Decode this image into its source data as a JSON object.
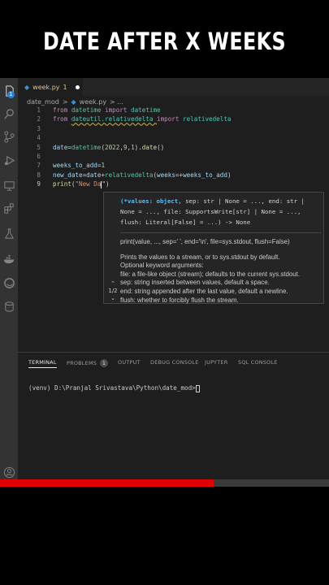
{
  "banner": {
    "title": "DATE AFTER X WEEKS"
  },
  "tab": {
    "filename": "week.py",
    "count": "1"
  },
  "breadcrumb": {
    "folder": "date_mod",
    "sep": ">",
    "file": "week.py",
    "more": "> ..."
  },
  "activity": {
    "badge": "1"
  },
  "code": {
    "lines": [
      {
        "n": "1",
        "parts": [
          [
            "kw",
            "from "
          ],
          [
            "mod",
            "datetime "
          ],
          [
            "kw",
            "import "
          ],
          [
            "mod",
            "datetime"
          ]
        ]
      },
      {
        "n": "2",
        "parts": [
          [
            "kw",
            "from "
          ],
          [
            "mod",
            "dateutil.relativedelta "
          ],
          [
            "kw",
            "import "
          ],
          [
            "mod",
            "relativedelta"
          ]
        ]
      },
      {
        "n": "3",
        "parts": []
      },
      {
        "n": "4",
        "parts": []
      },
      {
        "n": "5",
        "parts": [
          [
            "var",
            "date"
          ],
          [
            "op",
            "="
          ],
          [
            "mod",
            "datetime"
          ],
          [
            "op",
            "("
          ],
          [
            "num",
            "2022"
          ],
          [
            "op",
            ","
          ],
          [
            "num",
            "9"
          ],
          [
            "op",
            ","
          ],
          [
            "num",
            "1"
          ],
          [
            "op",
            ")."
          ],
          [
            "fn",
            "date"
          ],
          [
            "op",
            "()"
          ]
        ]
      },
      {
        "n": "6",
        "parts": []
      },
      {
        "n": "7",
        "parts": [
          [
            "var",
            "weeks_to_add"
          ],
          [
            "op",
            "="
          ],
          [
            "num",
            "1"
          ]
        ]
      },
      {
        "n": "8",
        "parts": [
          [
            "var",
            "new_date"
          ],
          [
            "op",
            "="
          ],
          [
            "var",
            "date"
          ],
          [
            "op",
            "+"
          ],
          [
            "mod",
            "relativedelta"
          ],
          [
            "op",
            "("
          ],
          [
            "var",
            "weeks"
          ],
          [
            "op",
            "=+"
          ],
          [
            "var",
            "weeks_to_add"
          ],
          [
            "op",
            ")"
          ]
        ]
      },
      {
        "n": "9",
        "parts": [
          [
            "fn",
            "print"
          ],
          [
            "op",
            "("
          ],
          [
            "str",
            "\"New Da"
          ],
          [
            "cursor",
            ""
          ],
          [
            "op",
            "\")"
          ]
        ]
      }
    ]
  },
  "hover": {
    "signature_bold": "(*values: object,",
    "signature_rest": " sep: str | None = ..., end: str | None = ..., file: SupportsWrite[str] | None = ..., flush: Literal[False] = ...) -> None",
    "doc_first": "print(value, ..., sep=' ', end='\\n', file=sys.stdout, flush=False)",
    "doc_lines": [
      "Prints the values to a stream, or to sys.stdout by default.",
      "Optional keyword arguments:",
      "file: a file-like object (stream); defaults to the current sys.stdout.",
      "sep: string inserted between values, default a space.",
      "end: string appended after the last value, default a newline.",
      "flush: whether to forcibly flush the stream."
    ],
    "pager": "1/2"
  },
  "panel": {
    "tabs": [
      "TERMINAL",
      "PROBLEMS",
      "OUTPUT",
      "DEBUG CONSOLE",
      "JUPYTER",
      "SQL CONSOLE"
    ],
    "problems_count": "1"
  },
  "terminal": {
    "prompt": "(venv) D:\\Pranjal Srivastava\\Python\\date_mod>"
  },
  "progress": {
    "fraction": 0.65
  }
}
